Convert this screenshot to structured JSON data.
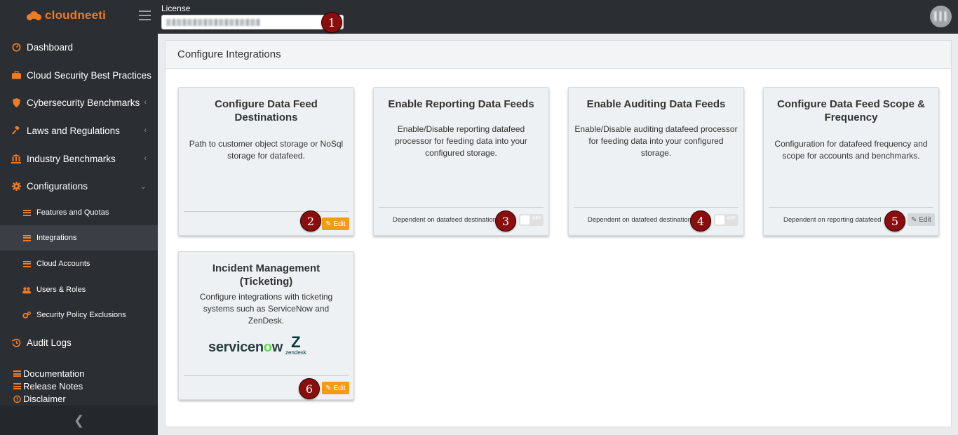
{
  "header": {
    "brand": "cloudneeti",
    "license_label": "License",
    "license_value": ""
  },
  "sidebar": {
    "items": [
      {
        "label": "Dashboard",
        "icon": "gauge-icon"
      },
      {
        "label": "Cloud Security Best Practices",
        "icon": "briefcase-icon"
      },
      {
        "label": "Cybersecurity Benchmarks",
        "icon": "shield-icon"
      },
      {
        "label": "Laws and Regulations",
        "icon": "gavel-icon"
      },
      {
        "label": "Industry Benchmarks",
        "icon": "institution-icon"
      },
      {
        "label": "Configurations",
        "icon": "gear-icon"
      }
    ],
    "sub_items": [
      {
        "label": "Features and Quotas",
        "icon": "list-icon"
      },
      {
        "label": "Integrations",
        "icon": "list-icon"
      },
      {
        "label": "Cloud Accounts",
        "icon": "list-icon"
      },
      {
        "label": "Users & Roles",
        "icon": "users-icon"
      },
      {
        "label": "Security Policy Exclusions",
        "icon": "gears-icon"
      }
    ],
    "audit_logs": "Audit Logs",
    "footer_links": [
      "Documentation",
      "Release Notes",
      "Disclaimer"
    ]
  },
  "main": {
    "title": "Configure Integrations",
    "cards": [
      {
        "title": "Configure Data Feed Destinations",
        "description": "Path to customer object storage or NoSql storage for datafeed.",
        "action": "Edit",
        "badge": "2"
      },
      {
        "title": "Enable Reporting Data Feeds",
        "description": "Enable/Disable reporting datafeed processor for feeding data into your configured storage.",
        "dependency": "Dependent on datafeed destinations",
        "toggle": "OFF",
        "badge": "3"
      },
      {
        "title": "Enable Auditing Data Feeds",
        "description": "Enable/Disable auditing datafeed processor for feeding data into your configured storage.",
        "dependency": "Dependent on datafeed destinations",
        "toggle": "OFF",
        "badge": "4"
      },
      {
        "title": "Configure Data Feed Scope & Frequency",
        "description": "Configuration for datafeed frequency and scope for accounts and benchmarks.",
        "dependency": "Dependent on reporting datafeed",
        "action": "Edit",
        "badge": "5"
      },
      {
        "title": "Incident Management (Ticketing)",
        "description": "Configure integrations with ticketing systems such as ServiceNow and ZenDesk.",
        "logos": [
          "servicenow",
          "zendesk"
        ],
        "action": "Edit",
        "badge": "6"
      }
    ]
  },
  "annotations": {
    "license_badge": "1"
  },
  "colors": {
    "accent": "#f07c22",
    "edit_button": "#f39c12",
    "sidebar_bg": "#2b2e33",
    "badge_bg": "#8b0e0e"
  }
}
